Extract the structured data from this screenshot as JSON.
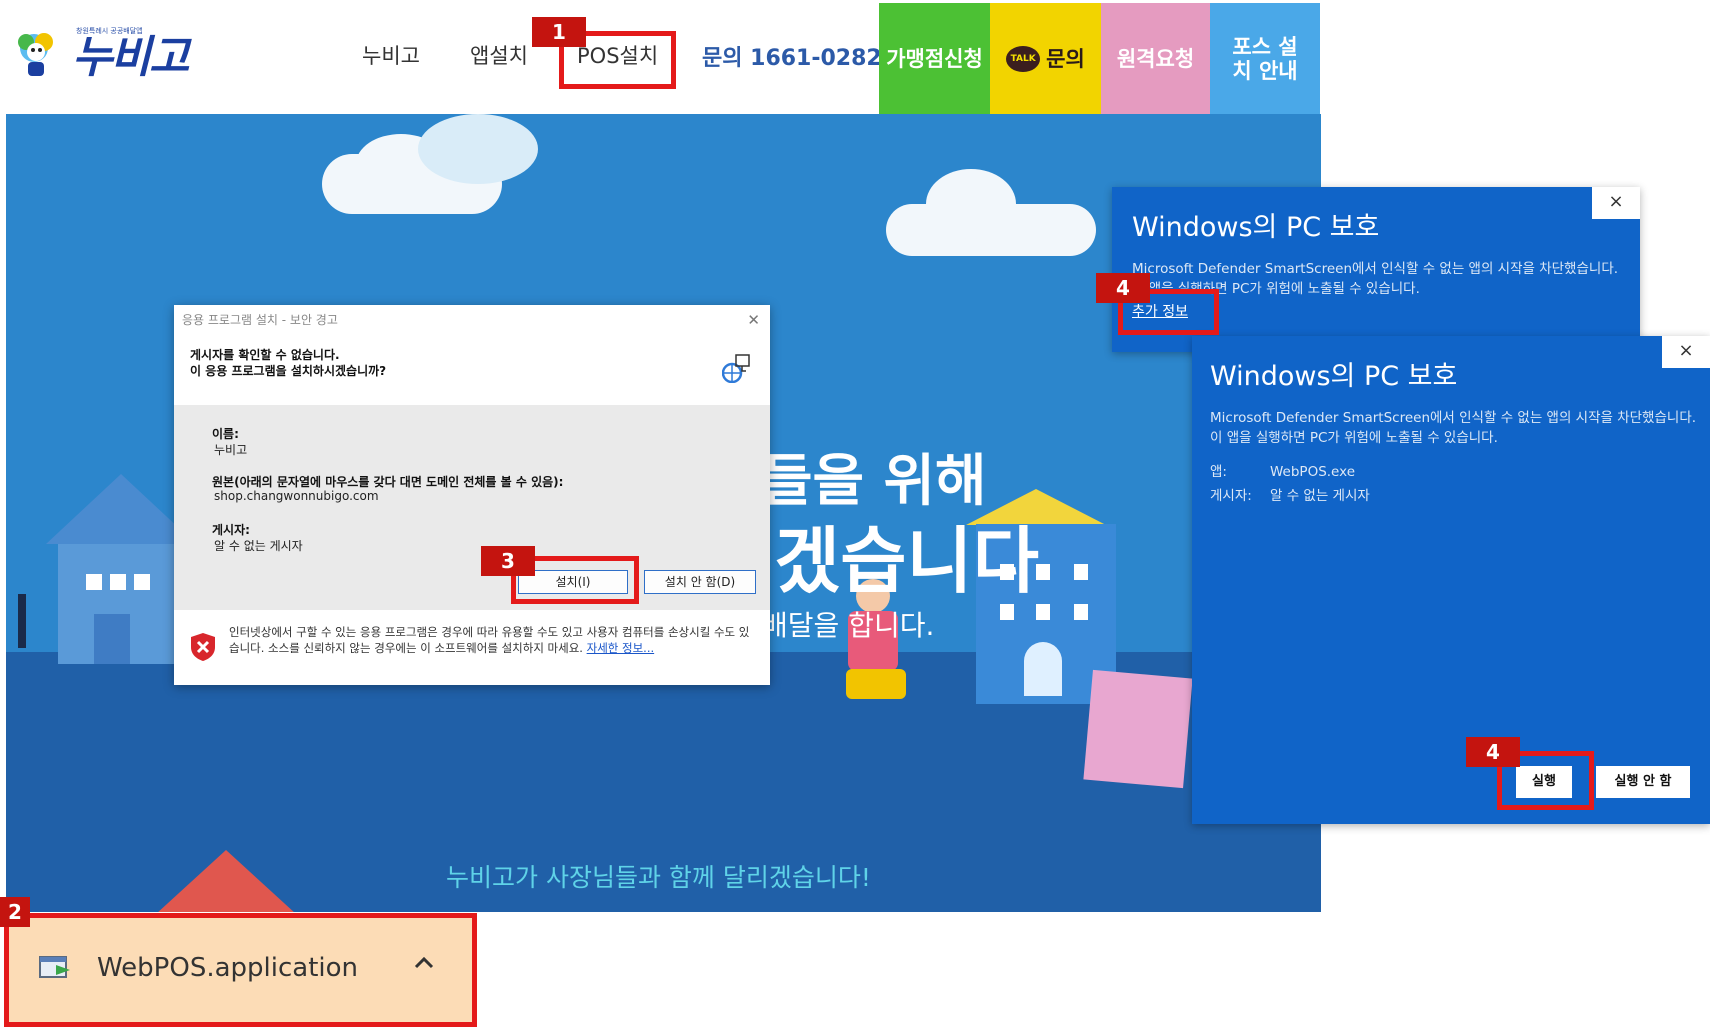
{
  "site": {
    "logo_text": "누비고",
    "logo_small": "창원특례시 공공배달앱"
  },
  "nav": {
    "items": [
      "누비고",
      "앱설치",
      "POS설치"
    ],
    "phone": "문의 1661-0282",
    "buttons": [
      {
        "label": "가맹점신청",
        "color": "#4cc134"
      },
      {
        "label": "문의",
        "color": "#f2d400",
        "talk_icon": "TALK"
      },
      {
        "label": "원격요청",
        "color": "#e59bc0"
      },
      {
        "label": "포스 설치 안내",
        "color": "#4aa8e8"
      }
    ]
  },
  "hero": {
    "line1_fragment": "들을 위해",
    "line2_fragment": "겠습니다",
    "line3_fragment": "배달을 합니다.",
    "bottom_text": "누비고가 사장님들과 함께 달리겠습니다!"
  },
  "install_dialog": {
    "title": "응용 프로그램 설치 - 보안 경고",
    "question_line1": "게시자를 확인할 수 없습니다.",
    "question_line2": "이 응용 프로그램을 설치하시겠습니까?",
    "name_label": "이름:",
    "name_value": "누비고",
    "source_label": "원본(아래의 문자열에 마우스를 갖다 대면 도메인 전체를 볼 수 있음):",
    "source_value": "shop.changwonnubigo.com",
    "publisher_label": "게시자:",
    "publisher_value": "알 수 없는 게시자",
    "install_button": "설치(I)",
    "cancel_button": "설치 안 함(D)",
    "footer_text": "인터넷상에서 구할 수 있는 응용 프로그램은 경우에 따라 유용할 수도 있고 사용자 컴퓨터를 손상시킬 수도 있습니다. 소스를 신뢰하지 않는 경우에는 이 소프트웨어를 설치하지 마세요.",
    "footer_link": "자세한 정보..."
  },
  "smartscreen_back": {
    "title": "Windows의 PC 보호",
    "text": "Microsoft Defender SmartScreen에서 인식할 수 없는 앱의 시작을 차단했습니다. 이 앱을 실행하면 PC가 위험에 노출될 수 있습니다.",
    "more_info": "추가 정보",
    "close": "×"
  },
  "smartscreen_front": {
    "title": "Windows의 PC 보호",
    "text": "Microsoft Defender SmartScreen에서 인식할 수 없는 앱의 시작을 차단했습니다. 이 앱을 실행하면 PC가 위험에 노출될 수 있습니다.",
    "app_label": "앱:",
    "app_value": "WebPOS.exe",
    "publisher_label": "게시자:",
    "publisher_value": "알 수 없는 게시자",
    "run_button": "실행",
    "dont_run_button": "실행 안 함",
    "close": "×"
  },
  "download": {
    "filename": "WebPOS.application",
    "chevron": "^"
  },
  "annotations": [
    "1",
    "2",
    "3",
    "4",
    "4"
  ],
  "colors": {
    "hero_sky": "#2c86cc",
    "smartscreen_blue": "#1064c8",
    "annotation_red": "#e41a1a",
    "download_bar": "#fcdcb6"
  }
}
